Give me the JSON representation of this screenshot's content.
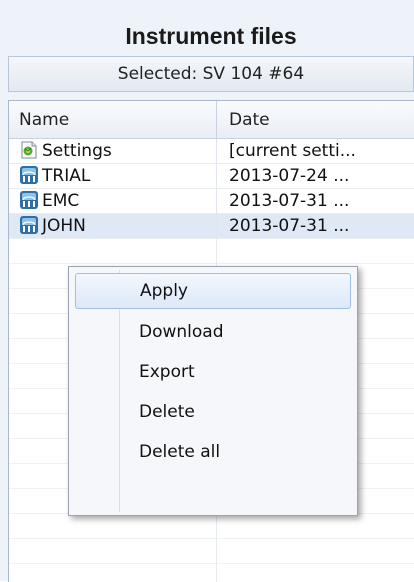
{
  "panel": {
    "title": "Instrument files",
    "selected": "Selected: SV 104 #64"
  },
  "grid": {
    "columns": [
      "Name",
      "Date"
    ],
    "rows": [
      {
        "name": "Settings",
        "date": "[current setti...",
        "icon": "settings-file-icon"
      },
      {
        "name": "TRIAL",
        "date": "2013-07-24 ...",
        "icon": "instrument-icon"
      },
      {
        "name": "EMC",
        "date": "2013-07-31 ...",
        "icon": "instrument-icon"
      },
      {
        "name": "JOHN",
        "date": "2013-07-31 ...",
        "icon": "instrument-icon"
      }
    ]
  },
  "context_menu": {
    "items": [
      "Apply",
      "Download",
      "Export",
      "Delete",
      "Delete all"
    ],
    "highlighted": "Apply"
  },
  "colors": {
    "panel_bg": "#eef3fa",
    "selection": "#dfe8f5",
    "menu_highlight": "#9dc0e6"
  }
}
